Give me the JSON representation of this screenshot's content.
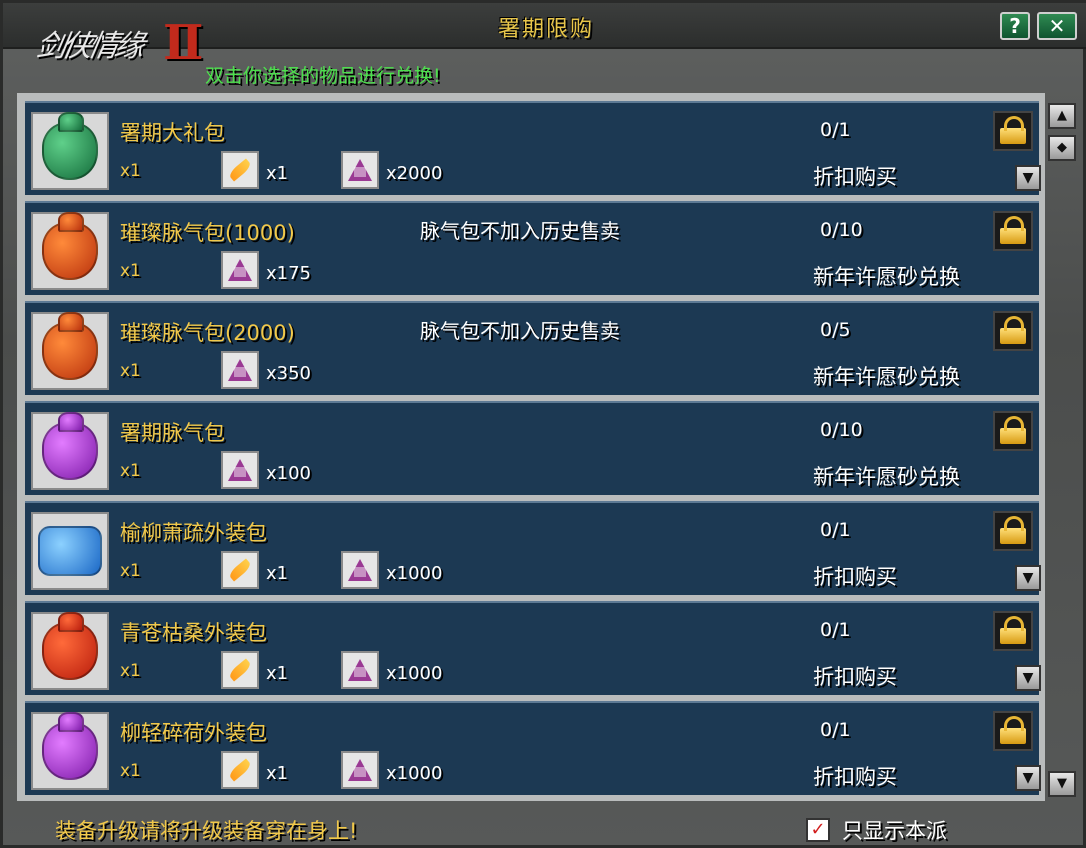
{
  "window": {
    "title": "署期限购",
    "help_label": "?",
    "close_label": "✕",
    "hint": "双击你选择的物品进行兑换!"
  },
  "items": [
    {
      "name": "署期大礼包",
      "qty": "x1",
      "note": "",
      "count": "0/1",
      "action": "折扣购买",
      "bag": "green",
      "mat1_qty": "x1",
      "mat2_qty": "x2000",
      "icon1": "feather-icon",
      "icon2": "crystal-icon"
    },
    {
      "name": "璀璨脉气包(1000)",
      "qty": "x1",
      "note": "脉气包不加入历史售卖",
      "count": "0/10",
      "action": "新年许愿砂兑换",
      "bag": "red",
      "mat1_qty": "x175"
    },
    {
      "name": "璀璨脉气包(2000)",
      "qty": "x1",
      "note": "脉气包不加入历史售卖",
      "count": "0/5",
      "action": "新年许愿砂兑换",
      "bag": "red",
      "mat1_qty": "x350"
    },
    {
      "name": "署期脉气包",
      "qty": "x1",
      "note": "",
      "count": "0/10",
      "action": "新年许愿砂兑换",
      "bag": "purple",
      "mat1_qty": "x100"
    },
    {
      "name": "榆柳萧疏外装包",
      "qty": "x1",
      "note": "",
      "count": "0/1",
      "action": "折扣购买",
      "bag": "blue",
      "mat1_qty": "x1",
      "mat2_qty": "x1000"
    },
    {
      "name": "青苍枯桑外装包",
      "qty": "x1",
      "note": "",
      "count": "0/1",
      "action": "折扣购买",
      "bag": "red2",
      "mat1_qty": "x1",
      "mat2_qty": "x1000"
    },
    {
      "name": "柳轻碎荷外装包",
      "qty": "x1",
      "note": "",
      "count": "0/1",
      "action": "折扣购买",
      "bag": "purple",
      "mat1_qty": "x1",
      "mat2_qty": "x1000"
    }
  ],
  "footer": {
    "tip": "装备升级请将升级装备穿在身上!",
    "checkbox_label": "只显示本派"
  },
  "colors": {
    "accent": "#f2c94a",
    "row_bg": "#1c3953",
    "hint": "#4de04d"
  }
}
